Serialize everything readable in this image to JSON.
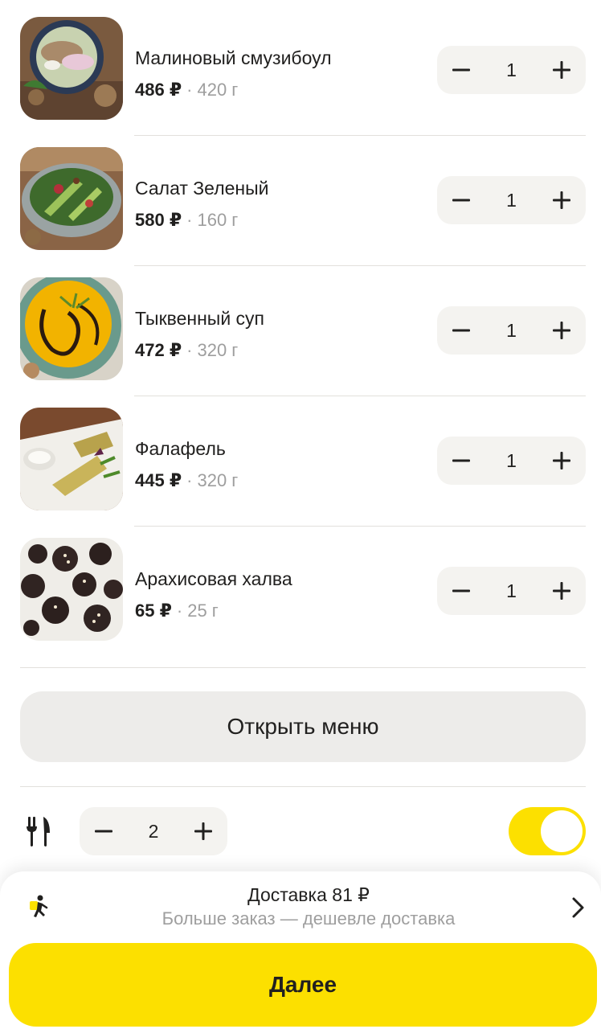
{
  "cart_items": [
    {
      "name": "Малиновый смузибоул",
      "price": "486 ₽",
      "separator": "·",
      "weight": "420 г",
      "quantity": "1",
      "image_icon": "smoothie-bowl-image"
    },
    {
      "name": "Салат Зеленый",
      "price": "580 ₽",
      "separator": "·",
      "weight": "160 г",
      "quantity": "1",
      "image_icon": "green-salad-image"
    },
    {
      "name": "Тыквенный суп",
      "price": "472 ₽",
      "separator": "·",
      "weight": "320 г",
      "quantity": "1",
      "image_icon": "pumpkin-soup-image"
    },
    {
      "name": "Фалафель",
      "price": "445 ₽",
      "separator": "·",
      "weight": "320 г",
      "quantity": "1",
      "image_icon": "falafel-image"
    },
    {
      "name": "Арахисовая халва",
      "price": "65 ₽",
      "separator": "·",
      "weight": "25 г",
      "quantity": "1",
      "image_icon": "peanut-halva-image"
    }
  ],
  "open_menu_label": "Открыть меню",
  "cutlery": {
    "icon": "fork-knife-icon",
    "quantity": "2",
    "toggle_on": true
  },
  "delivery": {
    "title": "Доставка 81 ₽",
    "subtitle": "Больше заказ — дешевле доставка",
    "icon": "runner-courier-icon"
  },
  "next_label": "Далее",
  "colors": {
    "accent_yellow": "#fce000",
    "stepper_bg": "#f4f3f0",
    "text_primary": "#21201f",
    "text_secondary": "#9e9e9e"
  }
}
